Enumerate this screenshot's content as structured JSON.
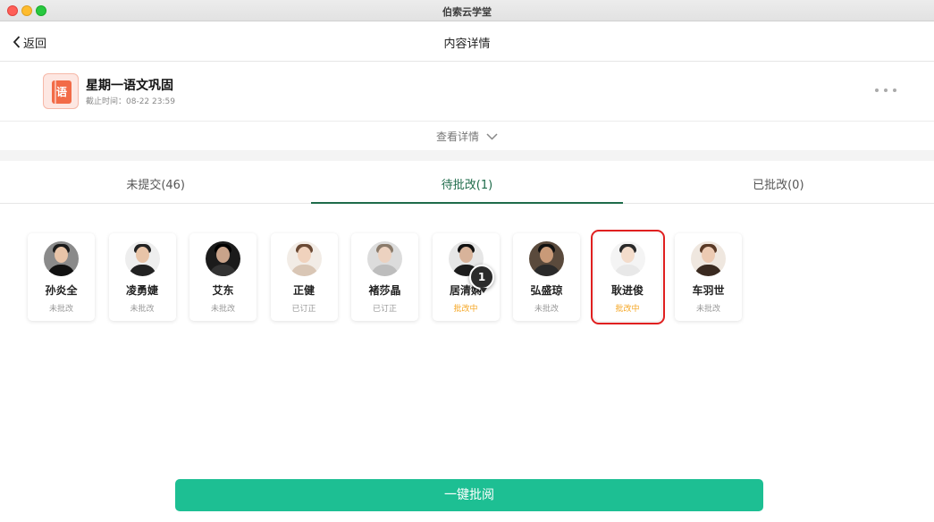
{
  "window": {
    "title": "伯索云学堂"
  },
  "navbar": {
    "back_label": "返回",
    "title": "内容详情"
  },
  "task": {
    "icon_char": "语",
    "name": "星期一语文巩固",
    "deadline": "截止时间：08-22 23:59"
  },
  "details": {
    "label": "查看详情"
  },
  "tabs": [
    {
      "label": "未提交(46)",
      "active": false
    },
    {
      "label": "待批改(1)",
      "active": true
    },
    {
      "label": "已批改(0)",
      "active": false
    }
  ],
  "students": [
    {
      "name": "孙炎全",
      "status": "未批改",
      "selected": false
    },
    {
      "name": "凌勇婕",
      "status": "未批改",
      "selected": false
    },
    {
      "name": "艾东",
      "status": "未批改",
      "selected": false
    },
    {
      "name": "正健",
      "status": "已订正",
      "selected": false
    },
    {
      "name": "褚莎晶",
      "status": "已订正",
      "selected": false
    },
    {
      "name": "居清娴",
      "status": "批改中",
      "selected": false
    },
    {
      "name": "弘盛琼",
      "status": "未批改",
      "selected": false
    },
    {
      "name": "耿进俊",
      "status": "批改中",
      "selected": true
    },
    {
      "name": "车羽世",
      "status": "未批改",
      "selected": false
    }
  ],
  "cursor_badge": "1",
  "review_button": "一键批阅",
  "colors": {
    "accent": "#1e6b4a",
    "button": "#1dbf93",
    "pending": "#f5a623",
    "highlight": "#e02020"
  }
}
